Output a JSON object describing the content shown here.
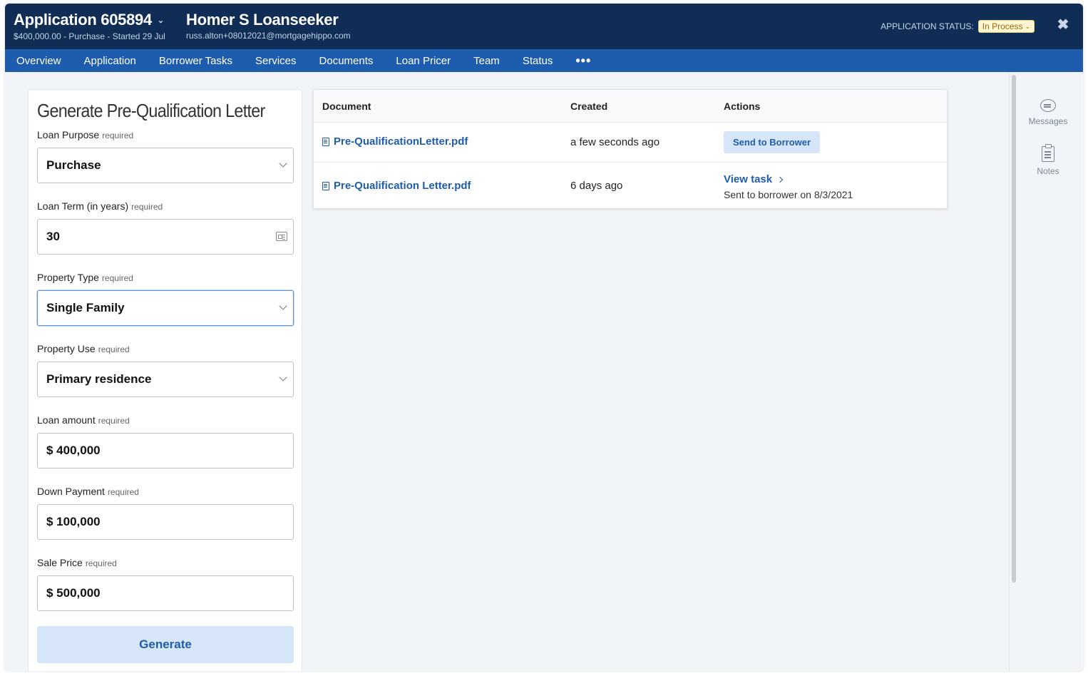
{
  "header": {
    "app_title": "Application 605894",
    "app_subtitle": "$400,000.00 - Purchase - Started 29 Jul",
    "borrower_name": "Homer S Loanseeker",
    "borrower_email": "russ.alton+08012021@mortgagehippo.com",
    "status_label": "APPLICATION STATUS:",
    "status_value": "In Process",
    "close_icon": "close-icon"
  },
  "nav": {
    "items": [
      "Overview",
      "Application",
      "Borrower Tasks",
      "Services",
      "Documents",
      "Loan Pricer",
      "Team",
      "Status"
    ],
    "more": "•••"
  },
  "form": {
    "title": "Generate Pre-Qualification Letter",
    "required_text": "required",
    "fields": [
      {
        "label": "Loan Purpose",
        "value": "Purchase",
        "type": "select"
      },
      {
        "label": "Loan Term (in years)",
        "value": "30",
        "type": "input"
      },
      {
        "label": "Property Type",
        "value": "Single Family",
        "type": "select"
      },
      {
        "label": "Property Use",
        "value": "Primary residence",
        "type": "select"
      },
      {
        "label": "Loan amount",
        "value": "$ 400,000",
        "type": "input"
      },
      {
        "label": "Down Payment",
        "value": "$ 100,000",
        "type": "input"
      },
      {
        "label": "Sale Price",
        "value": "$ 500,000",
        "type": "input"
      }
    ],
    "generate_label": "Generate"
  },
  "documents": {
    "columns": [
      "Document",
      "Created",
      "Actions"
    ],
    "rows": [
      {
        "name": "Pre-QualificationLetter.pdf",
        "created": "a few seconds ago",
        "action_label": "Send to Borrower"
      },
      {
        "name": "Pre-Qualification Letter.pdf",
        "created": "6 days ago",
        "action_label": "View task",
        "action_note": "Sent to borrower on 8/3/2021"
      }
    ]
  },
  "rail": {
    "messages_label": "Messages",
    "notes_label": "Notes"
  },
  "colors": {
    "header_bg": "#0f2d55",
    "nav_bg": "#1e5cad",
    "link": "#1e5cad",
    "button_bg": "#d6e5f8",
    "status_badge_bg": "#fff7d6"
  }
}
